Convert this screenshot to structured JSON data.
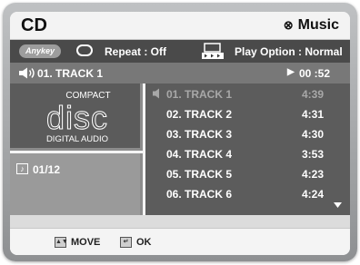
{
  "header": {
    "title": "CD",
    "mode_label": "Music"
  },
  "options": {
    "anykey_label": "Anykey",
    "repeat_label": "Repeat : Off",
    "play_option_label": "Play Option : Normal"
  },
  "now_playing": {
    "track": "01. TRACK 1",
    "elapsed": "00 :52"
  },
  "disc": {
    "logo_top": "COMPACT",
    "logo_main": "disc",
    "logo_bottom": "DIGITAL AUDIO"
  },
  "track_count": "01/12",
  "tracks": [
    {
      "name": "01. TRACK 1",
      "time": "4:39",
      "current": true
    },
    {
      "name": "02. TRACK 2",
      "time": "4:31",
      "current": false
    },
    {
      "name": "03. TRACK 3",
      "time": "4:30",
      "current": false
    },
    {
      "name": "04. TRACK 4",
      "time": "3:53",
      "current": false
    },
    {
      "name": "05. TRACK 5",
      "time": "4:23",
      "current": false
    },
    {
      "name": "06. TRACK 6",
      "time": "4:24",
      "current": false
    }
  ],
  "footer": {
    "move_label": "MOVE",
    "ok_label": "OK"
  },
  "icons": {
    "mode": "disc-icon",
    "repeat": "repeat-icon",
    "play_option": "play-option-icon",
    "now_playing": "speaker-icon",
    "playing_track": "speaker-icon",
    "count": "music-note-icon",
    "scroll": "scroll-down-icon",
    "move": "updown-arrows-icon",
    "ok": "enter-icon"
  },
  "colors": {
    "option_bar": "#4a4a4a",
    "now_bar": "#787878",
    "list_bg": "#5c5c5c",
    "current_track_text": "#a8a8a8"
  }
}
